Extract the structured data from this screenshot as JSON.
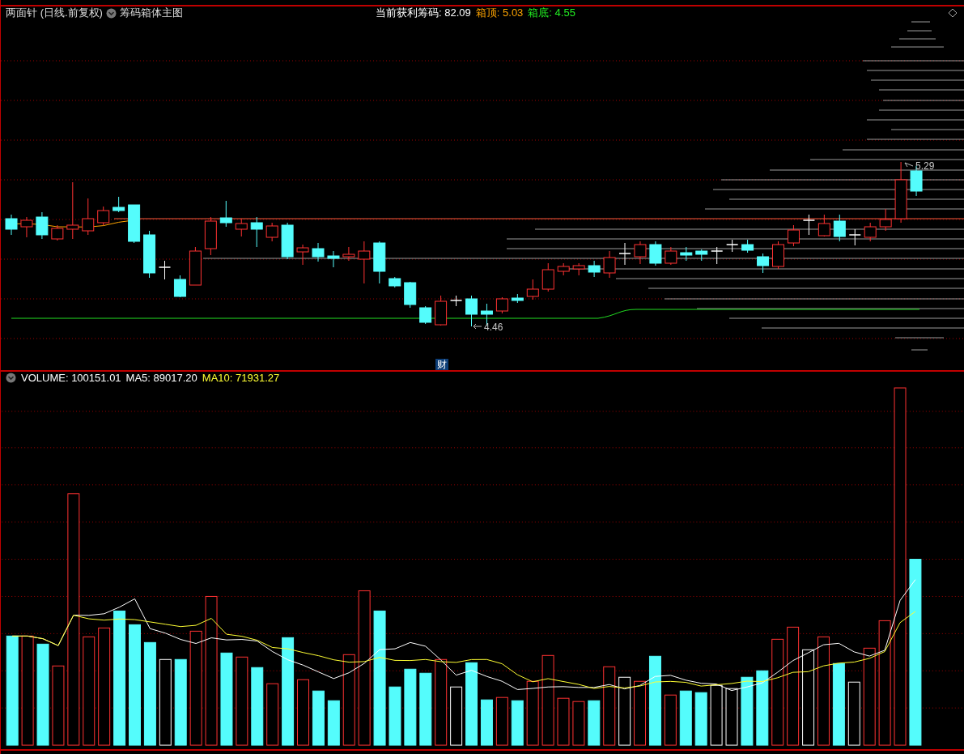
{
  "header": {
    "stock": "两面针",
    "period": "(日线.前复权)",
    "indicator": "筹码箱体主图"
  },
  "readouts": [
    {
      "label": "当前获利筹码:",
      "value": "82.09",
      "color": "#ffffff"
    },
    {
      "label": "箱顶:",
      "value": "5.03",
      "color": "#ffa500"
    },
    {
      "label": "箱底:",
      "value": "4.55",
      "color": "#22ee22"
    }
  ],
  "price_chart": {
    "high_label": "5.29",
    "low_label": "4.46",
    "badge": "财"
  },
  "volume": {
    "readouts": [
      {
        "label": "VOLUME:",
        "value": "100151.01",
        "color": "#ffffff"
      },
      {
        "label": "MA5:",
        "value": "89017.20",
        "color": "#ffffff"
      },
      {
        "label": "MA10:",
        "value": "71931.27",
        "color": "#ffff33"
      }
    ]
  }
}
